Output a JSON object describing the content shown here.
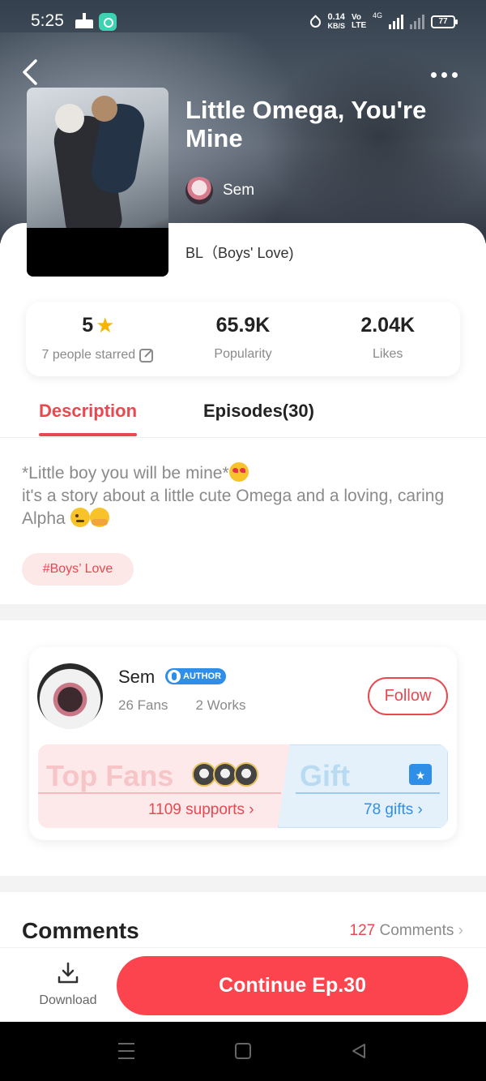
{
  "status_bar": {
    "time": "5:25",
    "net_speed_value": "0.14",
    "net_speed_unit": "KB/S",
    "volte": "Vo LTE",
    "network": "4G",
    "battery": "77"
  },
  "header": {
    "title": "Little Omega, You're Mine",
    "author": "Sem",
    "genre": "BL（Boys' Love)"
  },
  "stats": {
    "rating": "5",
    "rating_label": "7 people starred",
    "popularity": "65.9K",
    "popularity_label": "Popularity",
    "likes": "2.04K",
    "likes_label": "Likes"
  },
  "tabs": {
    "description": "Description",
    "episodes": "Episodes(30)"
  },
  "description": {
    "line1": "*Little boy you will be mine*",
    "line2": "it's a story about a little cute Omega and a loving, caring Alpha",
    "tag": "#Boys’ Love"
  },
  "author_card": {
    "name": "Sem",
    "badge": "AUTHOR",
    "fans": "26 Fans",
    "works": "2 Works",
    "follow_label": "Follow",
    "top_fans_title": "Top Fans",
    "supports": "1109 supports",
    "gift_title": "Gift",
    "gifts": "78 gifts"
  },
  "comments": {
    "title": "Comments",
    "count": "127",
    "label": "Comments"
  },
  "bottom_bar": {
    "download_label": "Download",
    "continue_label": "Continue Ep.30"
  },
  "colors": {
    "accent": "#fb444e",
    "link_blue": "#2f8fe8",
    "star": "#f7b500"
  },
  "icons": [
    "back-arrow-icon",
    "more-dots-icon",
    "star-icon",
    "edit-icon",
    "gift-icon",
    "chevron-right-icon",
    "download-icon"
  ]
}
